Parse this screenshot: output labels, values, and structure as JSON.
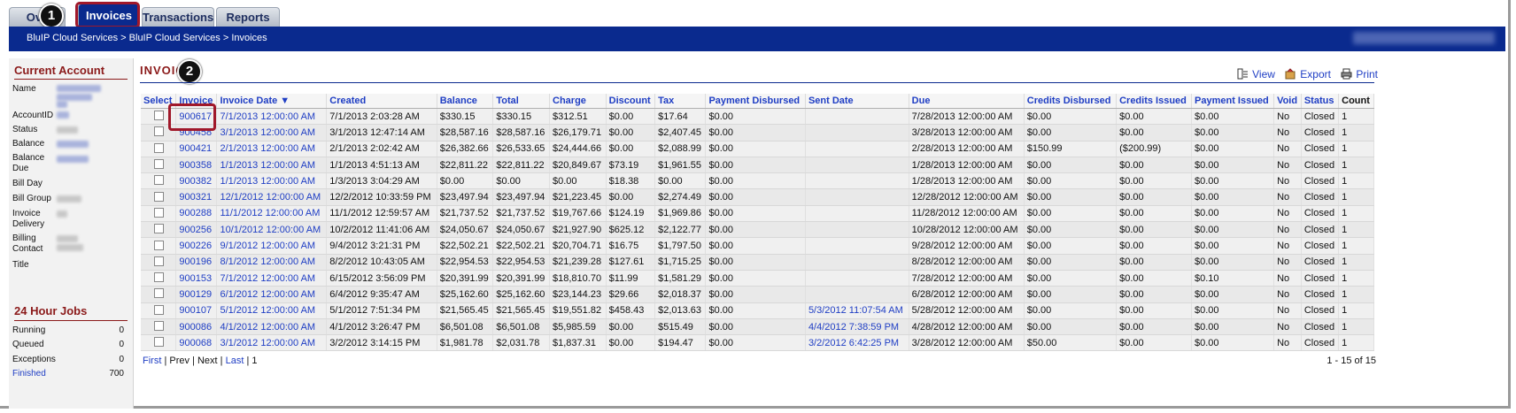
{
  "tabs": [
    {
      "label": "Ove",
      "active": false
    },
    {
      "label": "Invoices",
      "active": true
    },
    {
      "label": "Transactions",
      "active": false
    },
    {
      "label": "Reports",
      "active": false
    }
  ],
  "breadcrumb": "BluIP Cloud Services > BluIP Cloud Services > Invoices",
  "callouts": {
    "one": "1",
    "two": "2"
  },
  "sidebar": {
    "current_account_title": "Current Account",
    "fields": [
      "Name",
      "AccountID",
      "Status",
      "Balance",
      "Balance Due",
      "Bill Day",
      "Bill Group",
      "Invoice Delivery",
      "Billing Contact",
      "Title"
    ],
    "jobs_title": "24 Hour Jobs",
    "jobs": [
      {
        "label": "Running",
        "value": "0"
      },
      {
        "label": "Queued",
        "value": "0"
      },
      {
        "label": "Exceptions",
        "value": "0"
      },
      {
        "label": "Finished",
        "value": "700"
      }
    ]
  },
  "main": {
    "title": "INVOIC",
    "actions": {
      "view": "View",
      "export": "Export",
      "print": "Print"
    }
  },
  "table": {
    "headers": [
      "Select",
      "Invoice",
      "Invoice Date ▼",
      "Created",
      "Balance",
      "Total",
      "Charge",
      "Discount",
      "Tax",
      "Payment Disbursed",
      "Sent Date",
      "Due",
      "Credits Disbursed",
      "Credits Issued",
      "Payment Issued",
      "Void",
      "Status",
      "Count"
    ],
    "rows": [
      [
        "900617",
        "7/1/2013 12:00:00 AM",
        "7/1/2013 2:03:28 AM",
        "$330.15",
        "$330.15",
        "$312.51",
        "$0.00",
        "$17.64",
        "$0.00",
        "",
        "7/28/2013 12:00:00 AM",
        "$0.00",
        "$0.00",
        "$0.00",
        "No",
        "Closed",
        "1"
      ],
      [
        "900458",
        "3/1/2013 12:00:00 AM",
        "3/1/2013 12:47:14 AM",
        "$28,587.16",
        "$28,587.16",
        "$26,179.71",
        "$0.00",
        "$2,407.45",
        "$0.00",
        "",
        "3/28/2013 12:00:00 AM",
        "$0.00",
        "$0.00",
        "$0.00",
        "No",
        "Closed",
        "1"
      ],
      [
        "900421",
        "2/1/2013 12:00:00 AM",
        "2/1/2013 2:02:42 AM",
        "$26,382.66",
        "$26,533.65",
        "$24,444.66",
        "$0.00",
        "$2,088.99",
        "$0.00",
        "",
        "2/28/2013 12:00:00 AM",
        "$150.99",
        "($200.99)",
        "$0.00",
        "No",
        "Closed",
        "1"
      ],
      [
        "900358",
        "1/1/2013 12:00:00 AM",
        "1/1/2013 4:51:13 AM",
        "$22,811.22",
        "$22,811.22",
        "$20,849.67",
        "$73.19",
        "$1,961.55",
        "$0.00",
        "",
        "1/28/2013 12:00:00 AM",
        "$0.00",
        "$0.00",
        "$0.00",
        "No",
        "Closed",
        "1"
      ],
      [
        "900382",
        "1/1/2013 12:00:00 AM",
        "1/3/2013 3:04:29 AM",
        "$0.00",
        "$0.00",
        "$0.00",
        "$18.38",
        "$0.00",
        "$0.00",
        "",
        "1/28/2013 12:00:00 AM",
        "$0.00",
        "$0.00",
        "$0.00",
        "No",
        "Closed",
        "1"
      ],
      [
        "900321",
        "12/1/2012 12:00:00 AM",
        "12/2/2012 10:33:59 PM",
        "$23,497.94",
        "$23,497.94",
        "$21,223.45",
        "$0.00",
        "$2,274.49",
        "$0.00",
        "",
        "12/28/2012 12:00:00 AM",
        "$0.00",
        "$0.00",
        "$0.00",
        "No",
        "Closed",
        "1"
      ],
      [
        "900288",
        "11/1/2012 12:00:00 AM",
        "11/1/2012 12:59:57 AM",
        "$21,737.52",
        "$21,737.52",
        "$19,767.66",
        "$124.19",
        "$1,969.86",
        "$0.00",
        "",
        "11/28/2012 12:00:00 AM",
        "$0.00",
        "$0.00",
        "$0.00",
        "No",
        "Closed",
        "1"
      ],
      [
        "900256",
        "10/1/2012 12:00:00 AM",
        "10/2/2012 11:41:06 AM",
        "$24,050.67",
        "$24,050.67",
        "$21,927.90",
        "$625.12",
        "$2,122.77",
        "$0.00",
        "",
        "10/28/2012 12:00:00 AM",
        "$0.00",
        "$0.00",
        "$0.00",
        "No",
        "Closed",
        "1"
      ],
      [
        "900226",
        "9/1/2012 12:00:00 AM",
        "9/4/2012 3:21:31 PM",
        "$22,502.21",
        "$22,502.21",
        "$20,704.71",
        "$16.75",
        "$1,797.50",
        "$0.00",
        "",
        "9/28/2012 12:00:00 AM",
        "$0.00",
        "$0.00",
        "$0.00",
        "No",
        "Closed",
        "1"
      ],
      [
        "900196",
        "8/1/2012 12:00:00 AM",
        "8/2/2012 10:43:05 AM",
        "$22,954.53",
        "$22,954.53",
        "$21,239.28",
        "$127.61",
        "$1,715.25",
        "$0.00",
        "",
        "8/28/2012 12:00:00 AM",
        "$0.00",
        "$0.00",
        "$0.00",
        "No",
        "Closed",
        "1"
      ],
      [
        "900153",
        "7/1/2012 12:00:00 AM",
        "6/15/2012 3:56:09 PM",
        "$20,391.99",
        "$20,391.99",
        "$18,810.70",
        "$11.99",
        "$1,581.29",
        "$0.00",
        "",
        "7/28/2012 12:00:00 AM",
        "$0.00",
        "$0.00",
        "$0.10",
        "No",
        "Closed",
        "1"
      ],
      [
        "900129",
        "6/1/2012 12:00:00 AM",
        "6/4/2012 9:35:47 AM",
        "$25,162.60",
        "$25,162.60",
        "$23,144.23",
        "$29.66",
        "$2,018.37",
        "$0.00",
        "",
        "6/28/2012 12:00:00 AM",
        "$0.00",
        "$0.00",
        "$0.00",
        "No",
        "Closed",
        "1"
      ],
      [
        "900107",
        "5/1/2012 12:00:00 AM",
        "5/1/2012 7:51:34 PM",
        "$21,565.45",
        "$21,565.45",
        "$19,551.82",
        "$458.43",
        "$2,013.63",
        "$0.00",
        "5/3/2012 11:07:54 AM",
        "5/28/2012 12:00:00 AM",
        "$0.00",
        "$0.00",
        "$0.00",
        "No",
        "Closed",
        "1"
      ],
      [
        "900086",
        "4/1/2012 12:00:00 AM",
        "4/1/2012 3:26:47 PM",
        "$6,501.08",
        "$6,501.08",
        "$5,985.59",
        "$0.00",
        "$515.49",
        "$0.00",
        "4/4/2012 7:38:59 PM",
        "4/28/2012 12:00:00 AM",
        "$0.00",
        "$0.00",
        "$0.00",
        "No",
        "Closed",
        "1"
      ],
      [
        "900068",
        "3/1/2012 12:00:00 AM",
        "3/2/2012 3:14:15 PM",
        "$1,981.78",
        "$2,031.78",
        "$1,837.31",
        "$0.00",
        "$194.47",
        "$0.00",
        "3/2/2012 6:42:25 PM",
        "3/28/2012 12:00:00 AM",
        "$50.00",
        "$0.00",
        "$0.00",
        "No",
        "Closed",
        "1"
      ]
    ]
  },
  "pager": {
    "first": "First",
    "prev": "Prev",
    "next": "Next",
    "last": "Last",
    "page": "1",
    "range": "1 - 15 of 15"
  },
  "colors": {
    "brand_blue": "#0a2a8e",
    "link_blue": "#1f3ec4",
    "section_red": "#8b1a1a",
    "callout_outline": "#a0182a"
  }
}
